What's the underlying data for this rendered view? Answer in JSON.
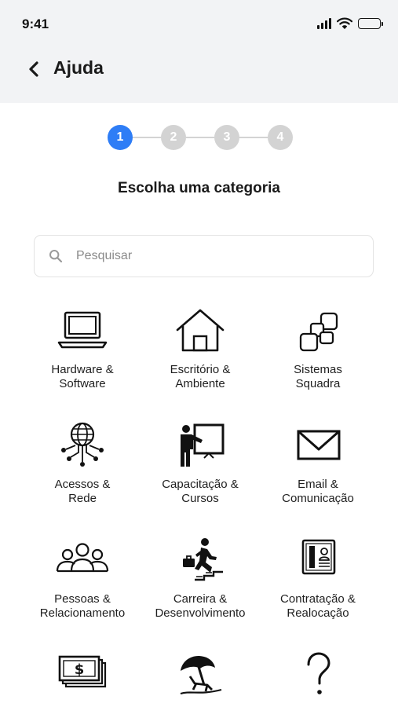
{
  "status": {
    "time": "9:41"
  },
  "header": {
    "title": "Ajuda"
  },
  "stepper": {
    "steps": [
      "1",
      "2",
      "3",
      "4"
    ],
    "active_step": 1
  },
  "subtitle": "Escolha uma categoria",
  "search": {
    "placeholder": "Pesquisar",
    "value": ""
  },
  "categories": [
    {
      "label": "Hardware &\nSoftware",
      "icon": "laptop-icon"
    },
    {
      "label": "Escritório &\nAmbiente",
      "icon": "house-icon"
    },
    {
      "label": "Sistemas\nSquadra",
      "icon": "squares-icon"
    },
    {
      "label": "Acessos &\nRede",
      "icon": "globe-network-icon"
    },
    {
      "label": "Capacitação &\nCursos",
      "icon": "presentation-icon"
    },
    {
      "label": "Email &\nComunicação",
      "icon": "envelope-icon"
    },
    {
      "label": "Pessoas &\nRelacionamento",
      "icon": "people-icon"
    },
    {
      "label": "Carreira &\nDesenvolvimento",
      "icon": "career-stairs-icon"
    },
    {
      "label": "Contratação &\nRealocação",
      "icon": "id-card-icon"
    },
    {
      "label": "",
      "icon": "money-icon"
    },
    {
      "label": "",
      "icon": "beach-umbrella-icon"
    },
    {
      "label": "",
      "icon": "question-mark-icon"
    }
  ],
  "colors": {
    "accent": "#2e7df6",
    "inactive_step": "#d3d3d3",
    "header_bg": "#f2f3f5"
  }
}
